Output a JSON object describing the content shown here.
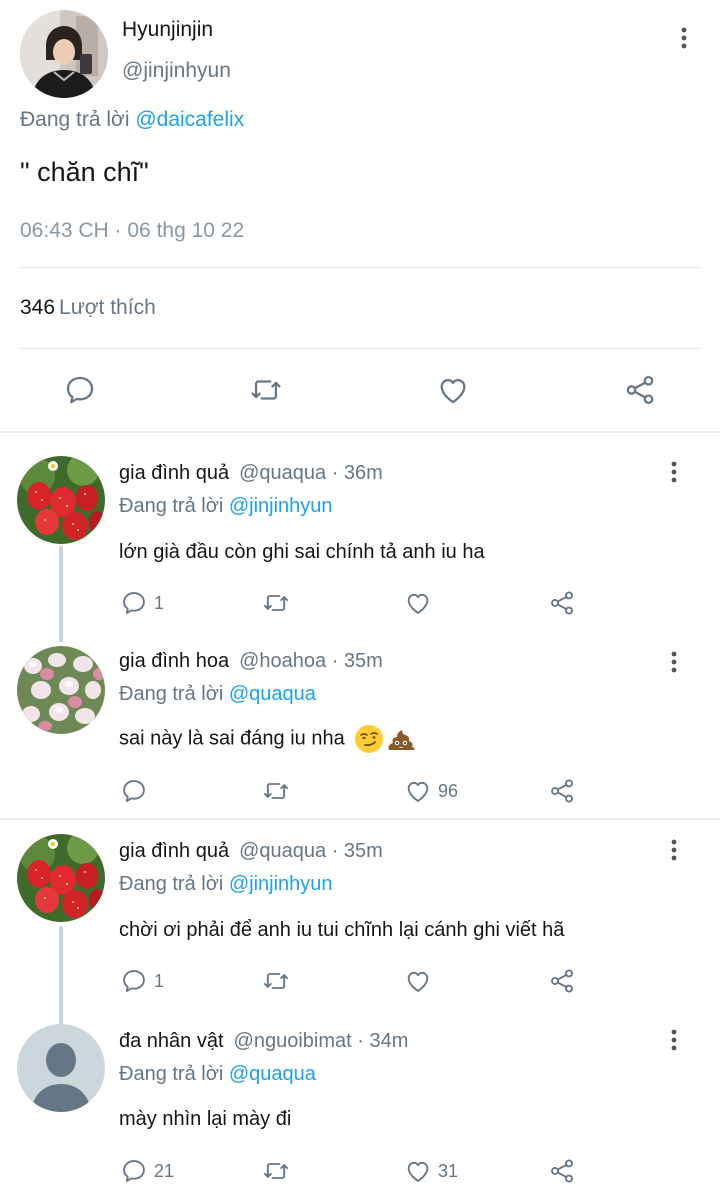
{
  "main_tweet": {
    "name": "Hyunjinjin",
    "handle": "@jinjinhyun",
    "reply_prefix": "Đang trả lời",
    "reply_mention": "@daicafelix",
    "text": "\" chăn chĩ\"",
    "timestamp": "06:43 CH · 06 thg 10 22",
    "likes_count": "346",
    "likes_label": "Lượt thích",
    "action_icons": [
      "comment-icon",
      "retweet-icon",
      "heart-icon",
      "share-icon"
    ]
  },
  "replies": [
    {
      "name": "gia đình quả",
      "handle": "@quaqua · 36m",
      "reply_prefix": "Đang trả lời",
      "reply_mention": "@jinjinhyun",
      "text": "lớn già đầu còn ghi sai chính tả anh iu ha",
      "comments": "1",
      "likes": "",
      "avatar": "strawberry-avatar"
    },
    {
      "name": "gia đình hoa",
      "handle": "@hoahoa · 35m",
      "reply_prefix": "Đang trả lời",
      "reply_mention": "@quaqua",
      "text": "sai này là sai đáng iu nha",
      "emojis": [
        "smirk-emoji",
        "poop-emoji"
      ],
      "comments": "",
      "likes": "96",
      "avatar": "flower-avatar"
    },
    {
      "name": "gia đình quả",
      "handle": "@quaqua · 35m",
      "reply_prefix": "Đang trả lời",
      "reply_mention": "@jinjinhyun",
      "text": "chời ơi phải để anh iu tui chĩnh lại cánh ghi viết hã",
      "comments": "1",
      "likes": "",
      "avatar": "strawberry-avatar"
    },
    {
      "name": "đa nhân vật",
      "handle": "@nguoibimat · 34m",
      "reply_prefix": "Đang trả lời",
      "reply_mention": "@quaqua",
      "text": "mày nhìn lại mày đi",
      "comments": "21",
      "likes": "31",
      "avatar": "default-avatar"
    }
  ],
  "colors": {
    "accent": "#1da1f2",
    "secondary_text": "#657786",
    "divider": "#e1e8ed"
  }
}
